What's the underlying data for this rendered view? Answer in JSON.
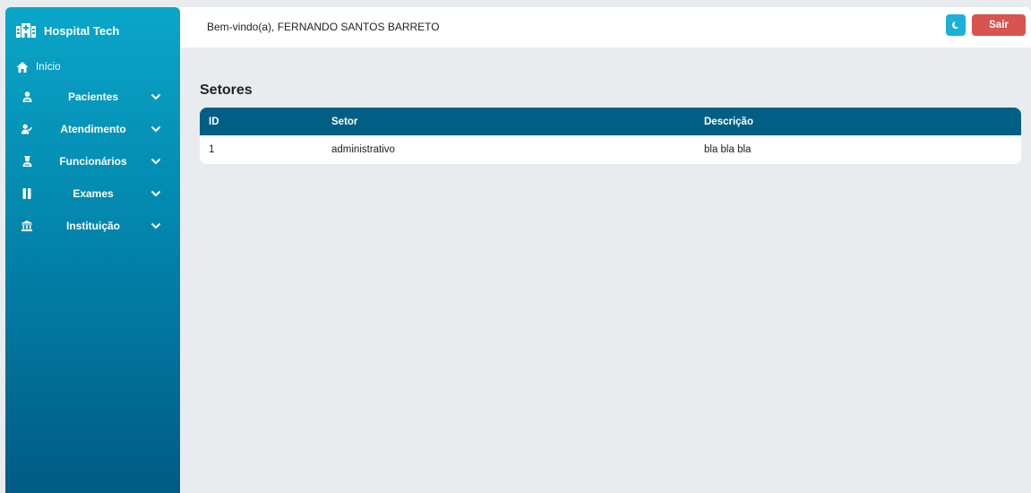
{
  "sidebar": {
    "brand_title": "Hospital Tech",
    "home_label": "Início",
    "items": [
      {
        "label": "Pacientes",
        "icon": "user-injured-icon"
      },
      {
        "label": "Atendimento",
        "icon": "user-check-icon"
      },
      {
        "label": "Funcionários",
        "icon": "user-nurse-icon"
      },
      {
        "label": "Exames",
        "icon": "vials-icon"
      },
      {
        "label": "Instituição",
        "icon": "landmark-icon"
      }
    ]
  },
  "header": {
    "welcome": "Bem-vindo(a), FERNANDO SANTOS BARRETO",
    "logout_label": "Sair"
  },
  "main": {
    "title": "Setores",
    "table": {
      "headers": [
        "ID",
        "Setor",
        "Descrição"
      ],
      "rows": [
        [
          "1",
          "administrativo",
          "bla bla bla"
        ]
      ]
    }
  },
  "colors": {
    "sidebar_top": "#0aa6c9",
    "sidebar_bottom": "#005b85",
    "table_header": "#015f86",
    "theme_button": "#1ab0d8",
    "logout_button": "#d9534f",
    "background": "#e9ecef"
  }
}
